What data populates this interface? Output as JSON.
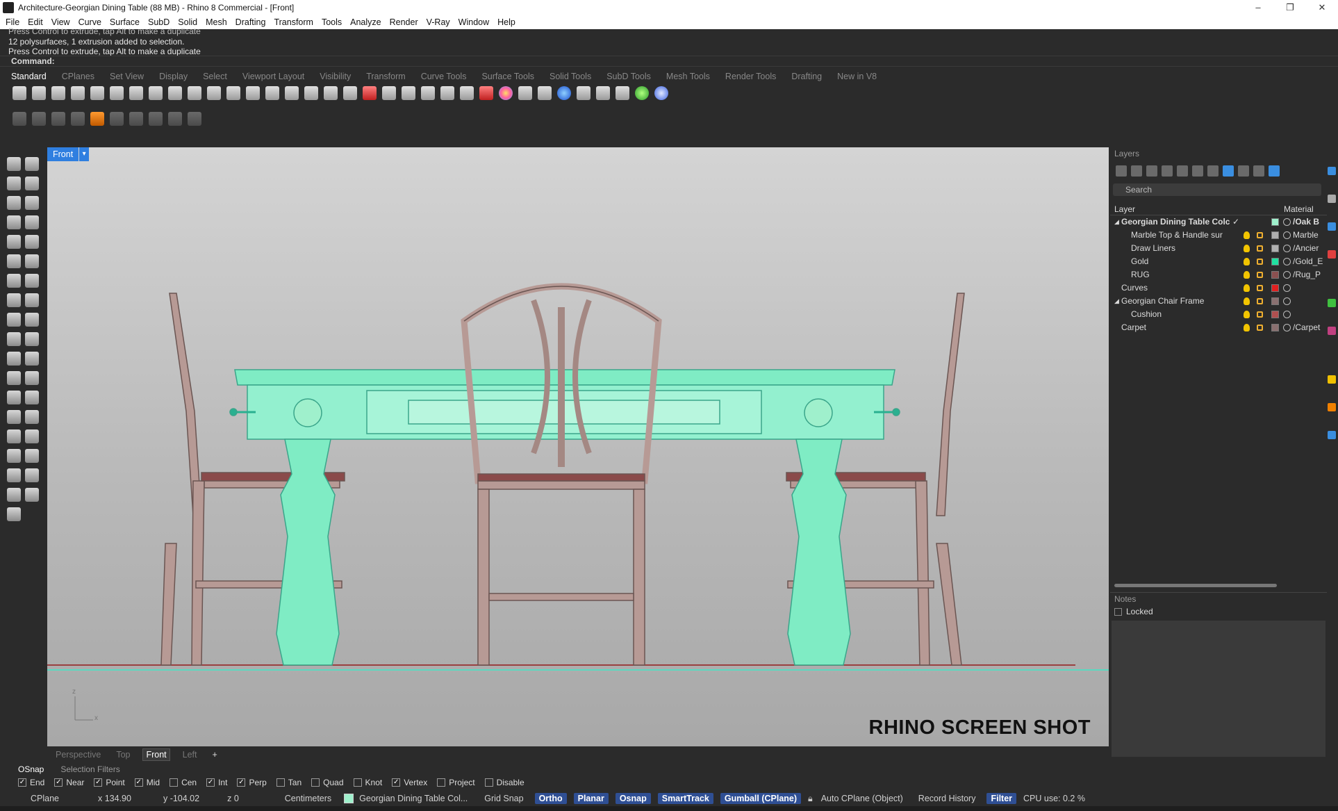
{
  "window": {
    "title": "Architecture-Georgian Dining Table (88 MB) - Rhino 8 Commercial - [Front]",
    "controls": [
      "–",
      "❐",
      "✕"
    ]
  },
  "menu": [
    "File",
    "Edit",
    "View",
    "Curve",
    "Surface",
    "SubD",
    "Solid",
    "Mesh",
    "Drafting",
    "Transform",
    "Tools",
    "Analyze",
    "Render",
    "V-Ray",
    "Window",
    "Help"
  ],
  "command": {
    "history": [
      "Press Control to extrude, tap Alt to make a duplicate",
      "12 polysurfaces, 1 extrusion added to selection.",
      "Press Control to extrude, tap Alt to make a duplicate"
    ],
    "prompt": "Command:"
  },
  "toolbar_tabs": [
    "Standard",
    "CPlanes",
    "Set View",
    "Display",
    "Select",
    "Viewport Layout",
    "Visibility",
    "Transform",
    "Curve Tools",
    "Surface Tools",
    "Solid Tools",
    "SubD Tools",
    "Mesh Tools",
    "Render Tools",
    "Drafting",
    "New in V8"
  ],
  "active_toolbar_tab": "Standard",
  "viewport": {
    "name": "Front",
    "dropdown_icon": "▾",
    "watermark": "RHINO SCREEN SHOT",
    "axis_labels": {
      "z": "z",
      "x": "x"
    }
  },
  "viewport_tabs": [
    "Perspective",
    "Top",
    "Front",
    "Left"
  ],
  "active_viewport_tab": "Front",
  "add_viewport_icon": "+",
  "layers_panel": {
    "title": "Layers",
    "search_placeholder": "Search",
    "col_layer": "Layer",
    "col_material": "Material",
    "rows": [
      {
        "name": "Georgian Dining Table Colc",
        "indent": 0,
        "expander": "◢",
        "bold": true,
        "current": "✓",
        "color": "#9ff0cc",
        "material": "/Oak B"
      },
      {
        "name": "Marble Top & Handle sur",
        "indent": 1,
        "expander": "",
        "bold": false,
        "current": "",
        "color": "#b0b0b0",
        "material": "Marble"
      },
      {
        "name": "Draw Liners",
        "indent": 1,
        "expander": "",
        "bold": false,
        "current": "",
        "color": "#b0b0b0",
        "material": "/Ancier"
      },
      {
        "name": "Gold",
        "indent": 1,
        "expander": "",
        "bold": false,
        "current": "",
        "color": "#20e0a0",
        "material": "/Gold_E"
      },
      {
        "name": "RUG",
        "indent": 1,
        "expander": "",
        "bold": false,
        "current": "",
        "color": "#8a5050",
        "material": "/Rug_P"
      },
      {
        "name": "Curves",
        "indent": 0,
        "expander": "",
        "bold": false,
        "current": "",
        "color": "#e02020",
        "material": ""
      },
      {
        "name": "Georgian Chair Frame",
        "indent": 0,
        "expander": "◢",
        "bold": false,
        "current": "",
        "color": "#8a7070",
        "material": ""
      },
      {
        "name": "Cushion",
        "indent": 1,
        "expander": "",
        "bold": false,
        "current": "",
        "color": "#b05050",
        "material": ""
      },
      {
        "name": "Carpet",
        "indent": 0,
        "expander": "",
        "bold": false,
        "current": "",
        "color": "#8a7070",
        "material": "/Carpet"
      }
    ]
  },
  "notes_panel": {
    "title": "Notes",
    "locked_label": "Locked"
  },
  "osnap_tabs": [
    "OSnap",
    "Selection Filters"
  ],
  "osnaps": [
    {
      "label": "End",
      "checked": true
    },
    {
      "label": "Near",
      "checked": true
    },
    {
      "label": "Point",
      "checked": true
    },
    {
      "label": "Mid",
      "checked": true
    },
    {
      "label": "Cen",
      "checked": false
    },
    {
      "label": "Int",
      "checked": true
    },
    {
      "label": "Perp",
      "checked": true
    },
    {
      "label": "Tan",
      "checked": false
    },
    {
      "label": "Quad",
      "checked": false
    },
    {
      "label": "Knot",
      "checked": false
    },
    {
      "label": "Vertex",
      "checked": true
    },
    {
      "label": "Project",
      "checked": false
    },
    {
      "label": "Disable",
      "checked": false
    }
  ],
  "status": {
    "cplane": "CPlane",
    "x": "x 134.90",
    "y": "y -104.02",
    "z": "z 0",
    "units": "Centimeters",
    "layer": "Georgian Dining Table Col...",
    "layer_color": "#9ff0cc",
    "grid_snap": "Grid Snap",
    "ortho": "Ortho",
    "planar": "Planar",
    "osnap": "Osnap",
    "smarttrack": "SmartTrack",
    "gumball": "Gumball (CPlane)",
    "auto_cplane": "Auto CPlane (Object)",
    "record_history": "Record History",
    "filter": "Filter",
    "cpu": "CPU use: 0.2 %"
  },
  "colors": {
    "accent_blue": "#2f7fe0",
    "active_button": "#2f4f94",
    "selected_geometry": "#7fecc4",
    "chair": "#b79a95"
  }
}
